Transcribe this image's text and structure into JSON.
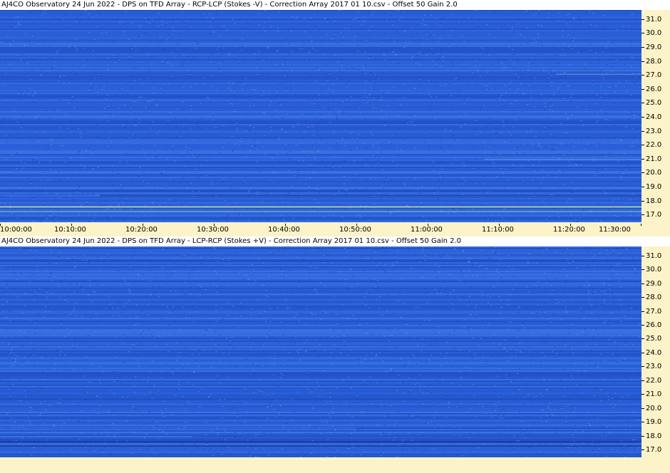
{
  "panels": [
    {
      "title": "AJ4CO Observatory 24 Jun 2022  -  DPS on TFD Array  -  RCP-LCP (Stokes -V)  -  Correction Array 2017 01 10.csv  -  Offset 50  Gain 2.0"
    },
    {
      "title": "AJ4CO Observatory 24 Jun 2022  -  DPS on TFD Array  -  LCP-RCP (Stokes +V)  -  Correction Array 2017 01 10.csv  -  Offset 50  Gain 2.0"
    }
  ],
  "chart_data": {
    "type": "heatmap",
    "x_tick_labels": [
      "10:00:00",
      "10:10:00",
      "10:20:00",
      "10:30:00",
      "10:40:00",
      "10:50:00",
      "11:00:00",
      "11:10:00",
      "11:20:00",
      "11:30:00"
    ],
    "y_tick_labels": [
      "31.0",
      "30.0",
      "29.0",
      "28.0",
      "27.0",
      "26.0",
      "25.0",
      "24.0",
      "23.0",
      "22.0",
      "21.0",
      "20.0",
      "19.0",
      "18.0",
      "17.0"
    ],
    "y_values_mhz": [
      31,
      30,
      29,
      28,
      27,
      26,
      25,
      24,
      23,
      22,
      21,
      20,
      19,
      18,
      17
    ],
    "ylim_mhz": [
      16.5,
      31.7
    ],
    "xlim": [
      "10:00:00",
      "11:30:00"
    ],
    "colors": {
      "background": "#2a5fd8",
      "dark_band": "#1a3fb0",
      "light_band": "#4f86ec",
      "bright_line": "#d8f080",
      "axis_bg": "#fcf3c8"
    }
  }
}
